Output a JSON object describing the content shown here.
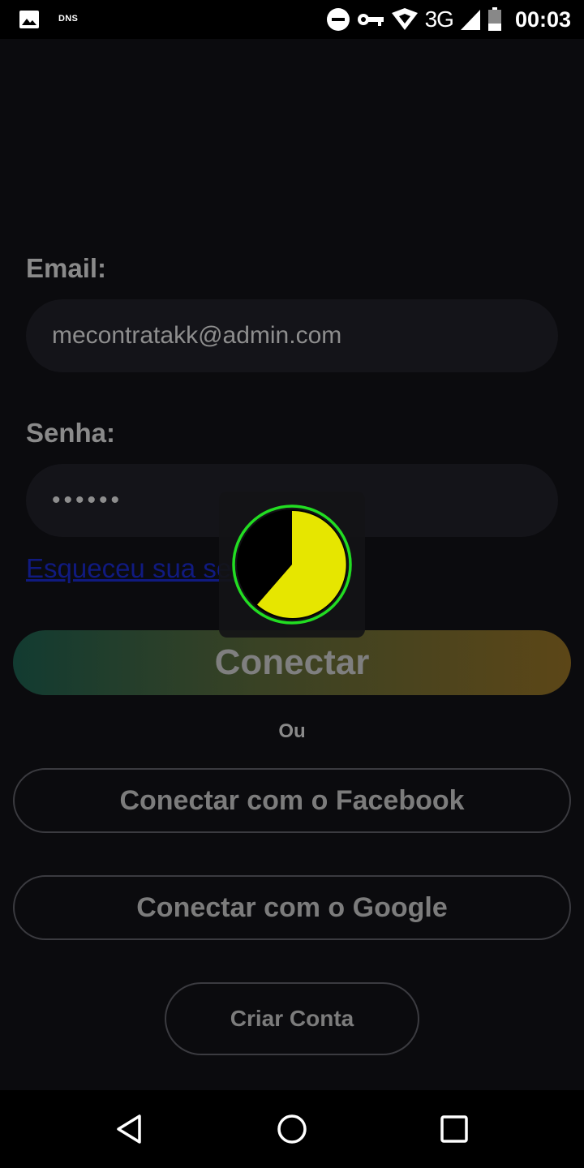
{
  "status_bar": {
    "dns_label": "DNS",
    "network": "3G",
    "time": "00:03",
    "icons": [
      "image-icon",
      "dns-icon",
      "do-not-disturb-icon",
      "vpn-key-icon",
      "wifi-icon",
      "signal-icon",
      "battery-icon"
    ]
  },
  "form": {
    "email_label": "Email:",
    "email_value": "mecontratakk@admin.com",
    "password_label": "Senha:",
    "password_value": "••••••",
    "forgot_link": "Esqueceu sua senha?"
  },
  "buttons": {
    "connect": "Conectar",
    "or": "Ou",
    "facebook": "Conectar com o Facebook",
    "google": "Conectar com o Google",
    "create_account": "Criar Conta"
  },
  "loader": {
    "icon": "loading-pie-icon",
    "fill_color": "#e6e600",
    "ring_color": "#22dd22"
  },
  "colors": {
    "background": "#0b0b0e",
    "field_background": "#141419",
    "link": "#101a80",
    "gradient_start": "#123b31",
    "gradient_end": "#5c4617"
  },
  "nav_bar": {
    "icons": [
      "back-icon",
      "home-icon",
      "recents-icon"
    ]
  }
}
